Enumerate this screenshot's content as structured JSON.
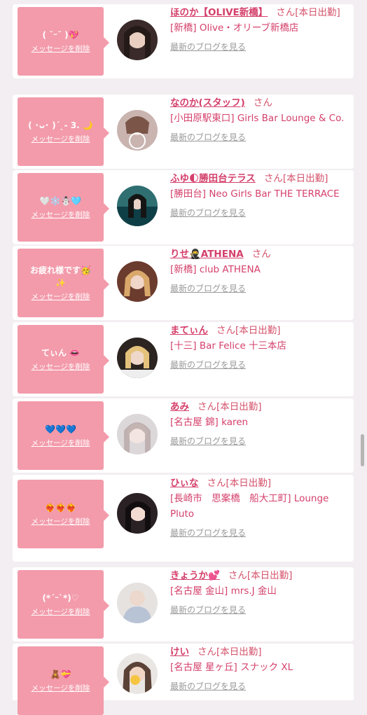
{
  "delete_label": "メッセージを削除",
  "blog_label": "最新のブログを見る",
  "san_label": "さん",
  "cards": [
    {
      "message": "( ˘ᵕ˘ )💖",
      "name": "ほのか【OLIVE新橋】",
      "status": "[本日出勤]",
      "shop": "[新橋] Olive・オリーブ新橋店",
      "avatar_color": "#3a2a2a"
    },
    {
      "message": "( ･ᴗ･ )ˊˎ- 3. 🌙",
      "name": "なのか(スタッフ)",
      "status": "",
      "shop": "[小田原駅東口] Girls Bar Lounge & Co.",
      "avatar_color": "#c9b4b0"
    },
    {
      "message": "🤍❄️☃️🩵",
      "name": "ふゆ🌓勝田台テラス",
      "status": "[本日出勤]",
      "shop": "[勝田台] Neo Girls Bar THE TERRACE",
      "avatar_color": "#2f6f72"
    },
    {
      "message": "お疲れ様です🥳\n✨",
      "name": "りせ🥷ATHENA",
      "status": "",
      "shop": "[新橋] club ATHENA",
      "avatar_color": "#6b3b2e"
    },
    {
      "message": "てぃん 👄",
      "name": "まてぃん",
      "status": "[本日出勤]",
      "shop": "[十三] Bar Felice 十三本店",
      "avatar_color": "#2b2420"
    },
    {
      "message": "💙💙💙",
      "name": "あみ",
      "status": "[本日出勤]",
      "shop": "[名古屋 錦] karen",
      "avatar_color": "#d9d4d6"
    },
    {
      "message": "❤️‍🔥❤️‍🔥❤️‍🔥",
      "name": "ひぃな",
      "status": "[本日出勤]",
      "shop": "[長崎市　思案橋　船大工町] Lounge Pluto",
      "avatar_color": "#2a2124"
    },
    {
      "message": "(*ˊᵕˋ*)♡",
      "name": "きょうか💕",
      "status": "[本日出勤]",
      "shop": "[名古屋 金山] mrs.J 金山",
      "avatar_color": "#d8d0cc"
    },
    {
      "message": "🧸💝",
      "name": "けい",
      "status": "[本日出勤]",
      "shop": "[名古屋 星ヶ丘] スナック XL",
      "avatar_color": "#8a6a58"
    }
  ]
}
